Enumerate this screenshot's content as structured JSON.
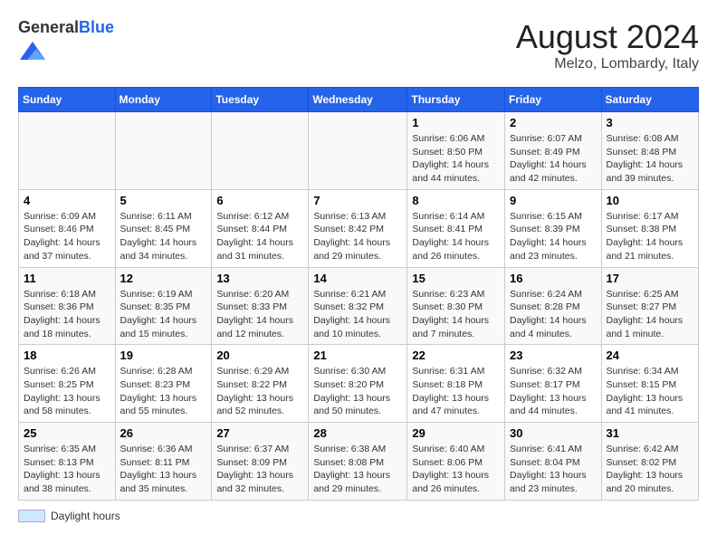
{
  "logo": {
    "general": "General",
    "blue": "Blue"
  },
  "header": {
    "title": "August 2024",
    "subtitle": "Melzo, Lombardy, Italy"
  },
  "days_of_week": [
    "Sunday",
    "Monday",
    "Tuesday",
    "Wednesday",
    "Thursday",
    "Friday",
    "Saturday"
  ],
  "weeks": [
    {
      "days": [
        {
          "number": "",
          "info": ""
        },
        {
          "number": "",
          "info": ""
        },
        {
          "number": "",
          "info": ""
        },
        {
          "number": "",
          "info": ""
        },
        {
          "number": "1",
          "info": "Sunrise: 6:06 AM\nSunset: 8:50 PM\nDaylight: 14 hours and 44 minutes."
        },
        {
          "number": "2",
          "info": "Sunrise: 6:07 AM\nSunset: 8:49 PM\nDaylight: 14 hours and 42 minutes."
        },
        {
          "number": "3",
          "info": "Sunrise: 6:08 AM\nSunset: 8:48 PM\nDaylight: 14 hours and 39 minutes."
        }
      ]
    },
    {
      "days": [
        {
          "number": "4",
          "info": "Sunrise: 6:09 AM\nSunset: 8:46 PM\nDaylight: 14 hours and 37 minutes."
        },
        {
          "number": "5",
          "info": "Sunrise: 6:11 AM\nSunset: 8:45 PM\nDaylight: 14 hours and 34 minutes."
        },
        {
          "number": "6",
          "info": "Sunrise: 6:12 AM\nSunset: 8:44 PM\nDaylight: 14 hours and 31 minutes."
        },
        {
          "number": "7",
          "info": "Sunrise: 6:13 AM\nSunset: 8:42 PM\nDaylight: 14 hours and 29 minutes."
        },
        {
          "number": "8",
          "info": "Sunrise: 6:14 AM\nSunset: 8:41 PM\nDaylight: 14 hours and 26 minutes."
        },
        {
          "number": "9",
          "info": "Sunrise: 6:15 AM\nSunset: 8:39 PM\nDaylight: 14 hours and 23 minutes."
        },
        {
          "number": "10",
          "info": "Sunrise: 6:17 AM\nSunset: 8:38 PM\nDaylight: 14 hours and 21 minutes."
        }
      ]
    },
    {
      "days": [
        {
          "number": "11",
          "info": "Sunrise: 6:18 AM\nSunset: 8:36 PM\nDaylight: 14 hours and 18 minutes."
        },
        {
          "number": "12",
          "info": "Sunrise: 6:19 AM\nSunset: 8:35 PM\nDaylight: 14 hours and 15 minutes."
        },
        {
          "number": "13",
          "info": "Sunrise: 6:20 AM\nSunset: 8:33 PM\nDaylight: 14 hours and 12 minutes."
        },
        {
          "number": "14",
          "info": "Sunrise: 6:21 AM\nSunset: 8:32 PM\nDaylight: 14 hours and 10 minutes."
        },
        {
          "number": "15",
          "info": "Sunrise: 6:23 AM\nSunset: 8:30 PM\nDaylight: 14 hours and 7 minutes."
        },
        {
          "number": "16",
          "info": "Sunrise: 6:24 AM\nSunset: 8:28 PM\nDaylight: 14 hours and 4 minutes."
        },
        {
          "number": "17",
          "info": "Sunrise: 6:25 AM\nSunset: 8:27 PM\nDaylight: 14 hours and 1 minute."
        }
      ]
    },
    {
      "days": [
        {
          "number": "18",
          "info": "Sunrise: 6:26 AM\nSunset: 8:25 PM\nDaylight: 13 hours and 58 minutes."
        },
        {
          "number": "19",
          "info": "Sunrise: 6:28 AM\nSunset: 8:23 PM\nDaylight: 13 hours and 55 minutes."
        },
        {
          "number": "20",
          "info": "Sunrise: 6:29 AM\nSunset: 8:22 PM\nDaylight: 13 hours and 52 minutes."
        },
        {
          "number": "21",
          "info": "Sunrise: 6:30 AM\nSunset: 8:20 PM\nDaylight: 13 hours and 50 minutes."
        },
        {
          "number": "22",
          "info": "Sunrise: 6:31 AM\nSunset: 8:18 PM\nDaylight: 13 hours and 47 minutes."
        },
        {
          "number": "23",
          "info": "Sunrise: 6:32 AM\nSunset: 8:17 PM\nDaylight: 13 hours and 44 minutes."
        },
        {
          "number": "24",
          "info": "Sunrise: 6:34 AM\nSunset: 8:15 PM\nDaylight: 13 hours and 41 minutes."
        }
      ]
    },
    {
      "days": [
        {
          "number": "25",
          "info": "Sunrise: 6:35 AM\nSunset: 8:13 PM\nDaylight: 13 hours and 38 minutes."
        },
        {
          "number": "26",
          "info": "Sunrise: 6:36 AM\nSunset: 8:11 PM\nDaylight: 13 hours and 35 minutes."
        },
        {
          "number": "27",
          "info": "Sunrise: 6:37 AM\nSunset: 8:09 PM\nDaylight: 13 hours and 32 minutes."
        },
        {
          "number": "28",
          "info": "Sunrise: 6:38 AM\nSunset: 8:08 PM\nDaylight: 13 hours and 29 minutes."
        },
        {
          "number": "29",
          "info": "Sunrise: 6:40 AM\nSunset: 8:06 PM\nDaylight: 13 hours and 26 minutes."
        },
        {
          "number": "30",
          "info": "Sunrise: 6:41 AM\nSunset: 8:04 PM\nDaylight: 13 hours and 23 minutes."
        },
        {
          "number": "31",
          "info": "Sunrise: 6:42 AM\nSunset: 8:02 PM\nDaylight: 13 hours and 20 minutes."
        }
      ]
    }
  ],
  "legend": {
    "label": "Daylight hours"
  }
}
